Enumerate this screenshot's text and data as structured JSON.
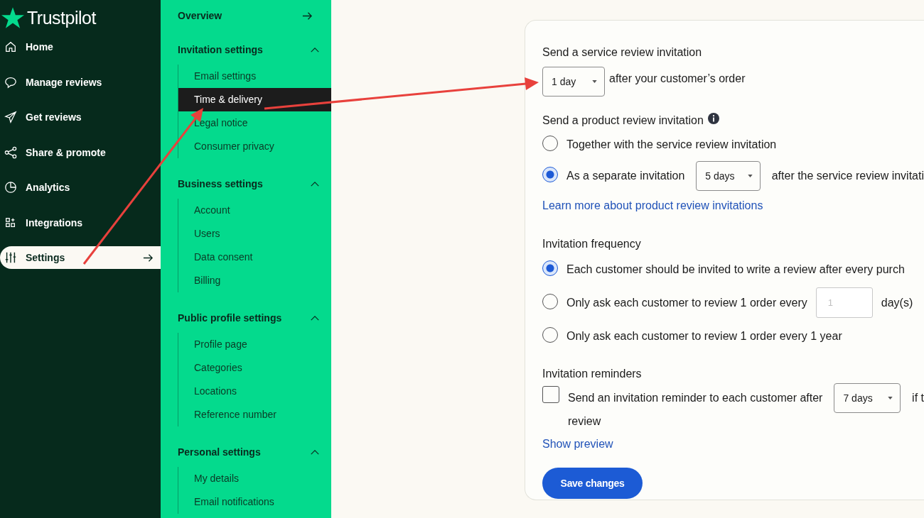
{
  "logo": "Trustpilot",
  "nav": [
    {
      "label": "Home",
      "selected": false
    },
    {
      "label": "Manage reviews",
      "selected": false
    },
    {
      "label": "Get reviews",
      "selected": false
    },
    {
      "label": "Share & promote",
      "selected": false
    },
    {
      "label": "Analytics",
      "selected": false
    },
    {
      "label": "Integrations",
      "selected": false
    },
    {
      "label": "Settings",
      "selected": true
    }
  ],
  "subnav": {
    "overview": "Overview",
    "sections": [
      {
        "title": "Invitation settings",
        "expanded": true,
        "items": [
          {
            "label": "Email settings",
            "selected": false
          },
          {
            "label": "Time & delivery",
            "selected": true
          },
          {
            "label": "Legal notice",
            "selected": false
          },
          {
            "label": "Consumer privacy",
            "selected": false
          }
        ]
      },
      {
        "title": "Business settings",
        "expanded": true,
        "items": [
          {
            "label": "Account",
            "selected": false
          },
          {
            "label": "Users",
            "selected": false
          },
          {
            "label": "Data consent",
            "selected": false
          },
          {
            "label": "Billing",
            "selected": false
          }
        ]
      },
      {
        "title": "Public profile settings",
        "expanded": true,
        "items": [
          {
            "label": "Profile page",
            "selected": false
          },
          {
            "label": "Categories",
            "selected": false
          },
          {
            "label": "Locations",
            "selected": false
          },
          {
            "label": "Reference number",
            "selected": false
          }
        ]
      },
      {
        "title": "Personal settings",
        "expanded": true,
        "items": [
          {
            "label": "My details",
            "selected": false
          },
          {
            "label": "Email notifications",
            "selected": false
          }
        ]
      }
    ]
  },
  "service": {
    "label": "Send a service review invitation",
    "select": "1 day",
    "suffix": "after your customer’s order"
  },
  "product": {
    "label": "Send a product review invitation",
    "options": [
      {
        "kind": "plain",
        "label": "Together with the service review invitation",
        "selected": false
      },
      {
        "kind": "select",
        "label": "As a separate invitation",
        "select": "5 days",
        "suffix": "after the service review invitati",
        "selected": true
      }
    ],
    "link": "Learn more about product review invitations"
  },
  "frequency": {
    "label": "Invitation frequency",
    "options": [
      {
        "kind": "plain",
        "label": "Each customer should be invited to write a review after every purch",
        "selected": true
      },
      {
        "kind": "input",
        "label": "Only ask each customer to review 1 order every",
        "placeholder": "1",
        "suffix": "day(s)",
        "selected": false
      },
      {
        "kind": "plain",
        "label": "Only ask each customer to review 1 order every 1 year",
        "selected": false
      }
    ]
  },
  "reminders": {
    "label": "Invitation reminders",
    "checked": false,
    "text": "Send an invitation reminder to each customer after",
    "select": "7 days",
    "suffix": "if t",
    "continuation": "review"
  },
  "preview_link": "Show preview",
  "save_button": "Save changes"
}
